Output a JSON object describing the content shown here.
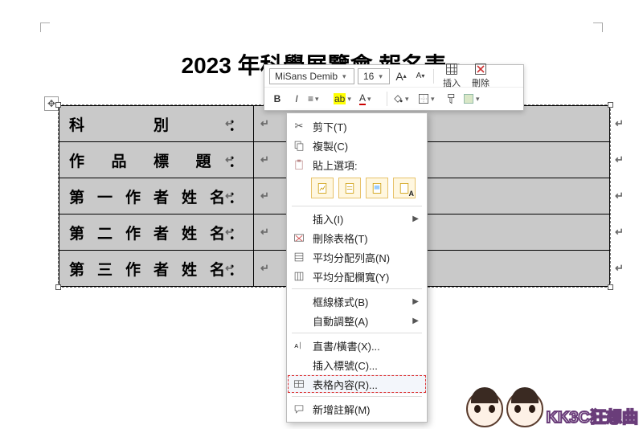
{
  "title": "2023 年科學展覽會  報名表",
  "table": {
    "rows": [
      {
        "label": "科別",
        "colon": "："
      },
      {
        "label": "作品標題",
        "colon": "："
      },
      {
        "label": "第一作者姓名",
        "colon": "："
      },
      {
        "label": "第二作者姓名",
        "colon": "："
      },
      {
        "label": "第三作者姓名",
        "colon": "："
      }
    ]
  },
  "miniToolbar": {
    "font": "MiSans Demib",
    "size": "16",
    "growA": "A",
    "shrinkA": "A",
    "insert": "插入",
    "delete": "刪除",
    "bold": "B",
    "italic": "I"
  },
  "contextMenu": {
    "cut": "剪下(T)",
    "copy": "複製(C)",
    "pasteOptions": "貼上選項:",
    "insert": "插入(I)",
    "deleteTable": "刪除表格(T)",
    "distributeRows": "平均分配列高(N)",
    "distributeCols": "平均分配欄寬(Y)",
    "borderStyle": "框線樣式(B)",
    "autofit": "自動調整(A)",
    "textDirection": "直書/橫書(X)...",
    "insertCaption": "插入標號(C)...",
    "tableProperties": "表格內容(R)...",
    "newComment": "新增註解(M)"
  },
  "watermark": "KK3C狂想曲"
}
